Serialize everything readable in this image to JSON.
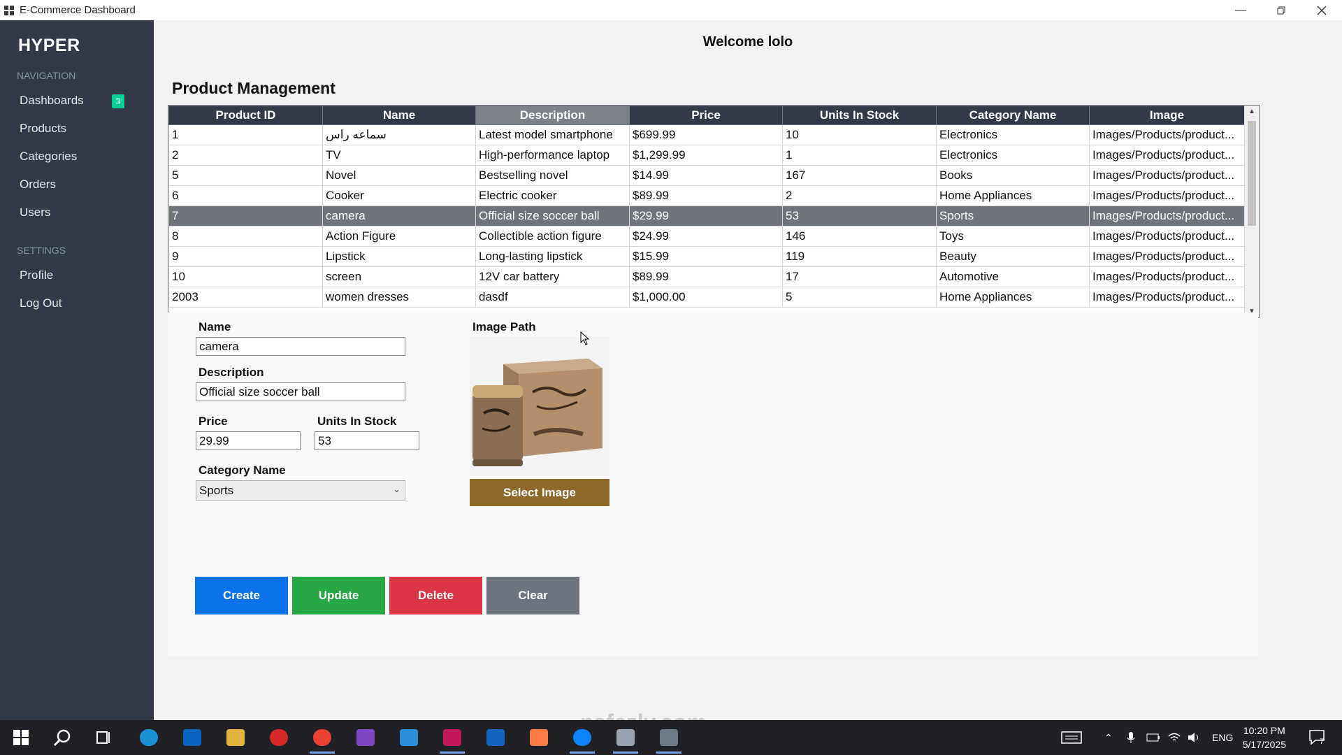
{
  "window": {
    "title": "E-Commerce Dashboard"
  },
  "sidebar": {
    "brand": "HYPER",
    "nav_label": "NAVIGATION",
    "items": [
      {
        "label": "Dashboards",
        "badge": "3"
      },
      {
        "label": "Products"
      },
      {
        "label": "Categories"
      },
      {
        "label": "Orders"
      },
      {
        "label": "Users"
      }
    ],
    "settings_label": "SETTINGS",
    "settings_items": [
      {
        "label": "Profile"
      },
      {
        "label": "Log Out"
      }
    ]
  },
  "header": {
    "welcome": "Welcome lolo"
  },
  "page": {
    "title": "Product Management"
  },
  "table": {
    "columns": [
      "Product ID",
      "Name",
      "Description",
      "Price",
      "Units In Stock",
      "Category Name",
      "Image"
    ],
    "rows": [
      [
        "1",
        "سماعه راس",
        "Latest model smartphone",
        "$699.99",
        "10",
        "Electronics",
        "Images/Products/product..."
      ],
      [
        "2",
        "TV",
        "High-performance laptop",
        "$1,299.99",
        "1",
        "Electronics",
        "Images/Products/product..."
      ],
      [
        "5",
        "Novel",
        "Bestselling novel",
        "$14.99",
        "167",
        "Books",
        "Images/Products/product..."
      ],
      [
        "6",
        "Cooker",
        "Electric cooker",
        "$89.99",
        "2",
        "Home Appliances",
        "Images/Products/product..."
      ],
      [
        "7",
        "camera",
        "Official size soccer ball",
        "$29.99",
        "53",
        "Sports",
        "Images/Products/product..."
      ],
      [
        "8",
        "Action Figure",
        "Collectible action figure",
        "$24.99",
        "146",
        "Toys",
        "Images/Products/product..."
      ],
      [
        "9",
        "Lipstick",
        "Long-lasting lipstick",
        "$15.99",
        "119",
        "Beauty",
        "Images/Products/product..."
      ],
      [
        "10",
        "screen",
        "12V car battery",
        "$89.99",
        "17",
        "Automotive",
        "Images/Products/product..."
      ],
      [
        "2003",
        "women dresses",
        "dasdf",
        "$1,000.00",
        "5",
        "Home Appliances",
        "Images/Products/product..."
      ]
    ]
  },
  "form": {
    "name_label": "Name",
    "name_value": "camera",
    "description_label": "Description",
    "description_value": "Official size soccer ball",
    "price_label": "Price",
    "price_value": "29.99",
    "units_label": "Units In Stock",
    "units_value": "53",
    "category_label": "Category Name",
    "category_value": "Sports",
    "image_path_label": "Image Path",
    "select_image_label": "Select Image"
  },
  "actions": {
    "create": "Create",
    "update": "Update",
    "delete": "Delete",
    "clear": "Clear"
  },
  "watermark": "nafezly.com",
  "taskbar": {
    "language": "ENG",
    "time": "10:20 PM",
    "date": "5/17/2025",
    "notification_count": "7"
  },
  "colors": {
    "sidebar_bg": "#313a46",
    "create": "#0d73eb",
    "update": "#28a745",
    "delete": "#dc3545",
    "clear": "#6c757d",
    "select_image": "#8d6a2a",
    "badge": "#0acf97"
  }
}
